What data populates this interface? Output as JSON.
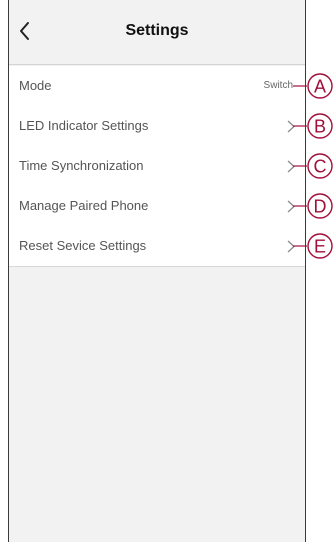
{
  "header": {
    "title": "Settings",
    "back_icon": "chevron-left-icon"
  },
  "settings": {
    "items": [
      {
        "label": "Mode",
        "value": "Switch"
      },
      {
        "label": "LED Indicator Settings"
      },
      {
        "label": "Time Synchronization"
      },
      {
        "label": "Manage Paired Phone"
      },
      {
        "label": "Reset Sevice Settings"
      }
    ]
  },
  "callouts": [
    "A",
    "B",
    "C",
    "D",
    "E"
  ],
  "colors": {
    "callout": "#a10f3a",
    "background": "#f2f2f2",
    "list_bg": "#ffffff"
  }
}
